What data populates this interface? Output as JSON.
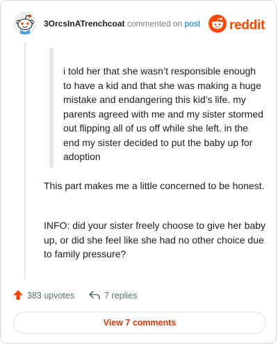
{
  "header": {
    "username": "3OrcsInATrenchcoat",
    "action": "commented on",
    "post_link": "post",
    "brand": "reddit"
  },
  "comment": {
    "quote": "i told her that she wasn’t responsible enough to have a kid and that she was making a huge mistake and endangering this kid’s life. my parents agreed with me and my sister stormed out flipping all of us off while she left. in the end my sister decided to put the baby up for adoption",
    "paragraphs": [
      "This part makes me a little concerned to be honest.",
      "INFO: did your sister freely choose to give her baby up, or did she feel like she had no other choice due to family pressure?"
    ]
  },
  "actions": {
    "upvotes": "383 upvotes",
    "replies": "7 replies",
    "view_comments": "View 7 comments"
  },
  "colors": {
    "brand": "#ff4500",
    "link": "#0079d3",
    "view_button_text": "#d93900"
  },
  "icons": [
    "snoo-avatar-icon",
    "reddit-logo-icon",
    "upvote-arrow-icon",
    "reply-arrow-icon"
  ]
}
